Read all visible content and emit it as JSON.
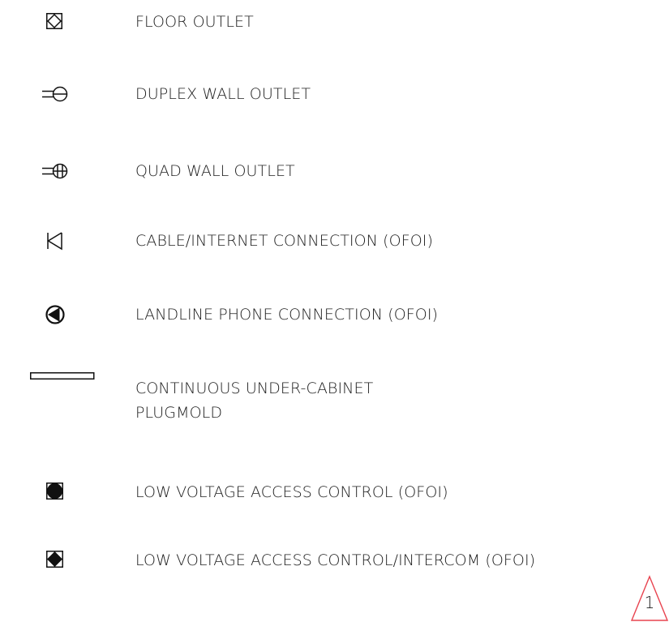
{
  "legend": {
    "items": [
      {
        "icon": "floor-outlet-icon",
        "label": "FLOOR OUTLET"
      },
      {
        "icon": "duplex-wall-outlet-icon",
        "label": "DUPLEX WALL OUTLET"
      },
      {
        "icon": "quad-wall-outlet-icon",
        "label": "QUAD WALL OUTLET"
      },
      {
        "icon": "cable-internet-connection-icon",
        "label": "CABLE/INTERNET CONNECTION (OFOI)"
      },
      {
        "icon": "landline-phone-connection-icon",
        "label": "LANDLINE PHONE CONNECTION (OFOI)"
      },
      {
        "icon": "plugmold-icon",
        "label_line1": "CONTINUOUS UNDER-CABINET",
        "label_line2": "PLUGMOLD"
      },
      {
        "icon": "access-control-icon",
        "label": "LOW VOLTAGE ACCESS CONTROL (OFOI)"
      },
      {
        "icon": "access-control-intercom-icon",
        "label": "LOW VOLTAGE ACCESS CONTROL/INTERCOM (OFOI)"
      }
    ]
  },
  "revision": {
    "icon": "revision-delta-icon",
    "number": "1",
    "color": "#e8434f"
  }
}
